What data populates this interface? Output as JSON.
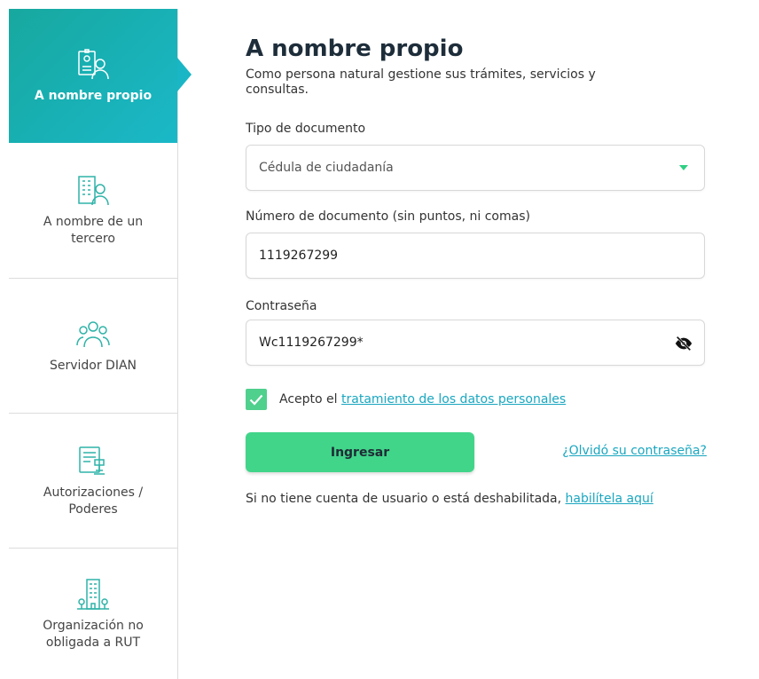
{
  "sidebar": {
    "items": [
      {
        "label": "A nombre propio",
        "icon": "id-card-person-icon",
        "active": true
      },
      {
        "label": "A nombre de un tercero",
        "icon": "building-person-icon",
        "active": false
      },
      {
        "label": "Servidor DIAN",
        "icon": "group-people-icon",
        "active": false
      },
      {
        "label": "Autorizaciones / Poderes",
        "icon": "document-stamp-icon",
        "active": false
      },
      {
        "label": "Organización no obligada a RUT",
        "icon": "building-trees-icon",
        "active": false
      }
    ]
  },
  "main": {
    "title": "A nombre propio",
    "subtitle": "Como persona natural gestione sus trámites, servicios y consultas.",
    "doc_type": {
      "label": "Tipo de documento",
      "value": "Cédula de ciudadanía"
    },
    "doc_number": {
      "label": "Número de documento (sin puntos, ni comas)",
      "value": "1119267299"
    },
    "password": {
      "label": "Contraseña",
      "value": "Wc1119267299*"
    },
    "consent": {
      "text": "Acepto el ",
      "link": "tratamiento de los datos personales",
      "checked": true
    },
    "submit_label": "Ingresar",
    "forgot_label": "¿Olvidó su contraseña?",
    "footer": {
      "text": "Si no tiene cuenta de usuario o está deshabilitada, ",
      "link": "habilítela aquí"
    }
  },
  "colors": {
    "accent": "#1ab6c5",
    "button": "#41d58a",
    "link": "#1aa7c0"
  }
}
